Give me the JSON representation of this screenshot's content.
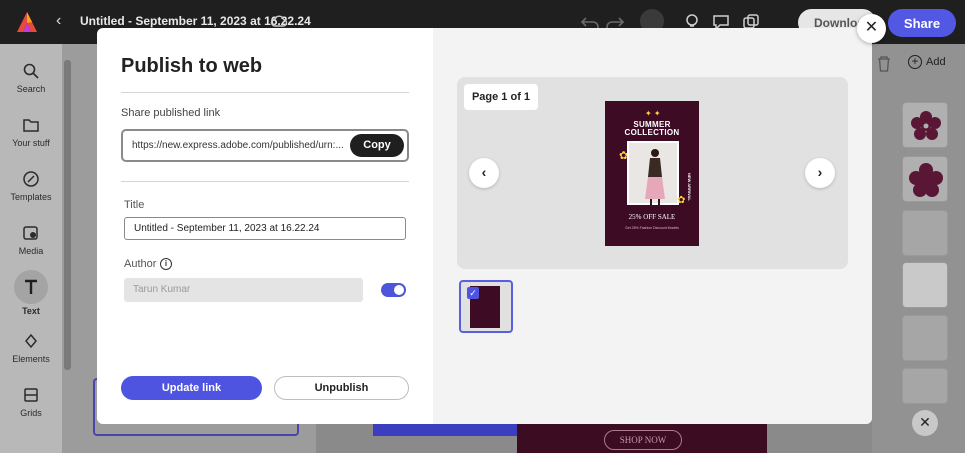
{
  "app": {
    "doc_title": "Untitled - September 11, 2023 at 16.22.24",
    "download_label": "Download",
    "share_label": "Share"
  },
  "left_rail": [
    {
      "label": "Search",
      "icon": "search-icon"
    },
    {
      "label": "Your stuff",
      "icon": "folder-icon"
    },
    {
      "label": "Templates",
      "icon": "templates-icon"
    },
    {
      "label": "Media",
      "icon": "media-icon"
    },
    {
      "label": "Text",
      "icon": "text-icon"
    },
    {
      "label": "Elements",
      "icon": "elements-icon"
    },
    {
      "label": "Grids",
      "icon": "grids-icon"
    }
  ],
  "right_panel": {
    "add_label": "Add"
  },
  "canvas": {
    "shop_now": "SHOP NOW"
  },
  "modal": {
    "title": "Publish to web",
    "share_label": "Share published link",
    "link_value": "https://new.express.adobe.com/published/urn:...",
    "copy_label": "Copy",
    "title_label": "Title",
    "title_value": "Untitled - September 11, 2023 at 16.22.24",
    "author_label": "Author",
    "author_value": "Tarun Kumar",
    "author_toggle_on": true,
    "update_label": "Update link",
    "unpublish_label": "Unpublish",
    "page_badge": "Page 1 of 1",
    "poster": {
      "title_line1": "SUMMER",
      "title_line2": "COLLECTION",
      "offer": "25% OFF SALE",
      "fine_print": "Get 25% Fashion Discount Models",
      "side_text": "NEW ARRIVAL"
    }
  },
  "colors": {
    "accent": "#4e54e0",
    "poster_bg": "#3d0b24"
  }
}
